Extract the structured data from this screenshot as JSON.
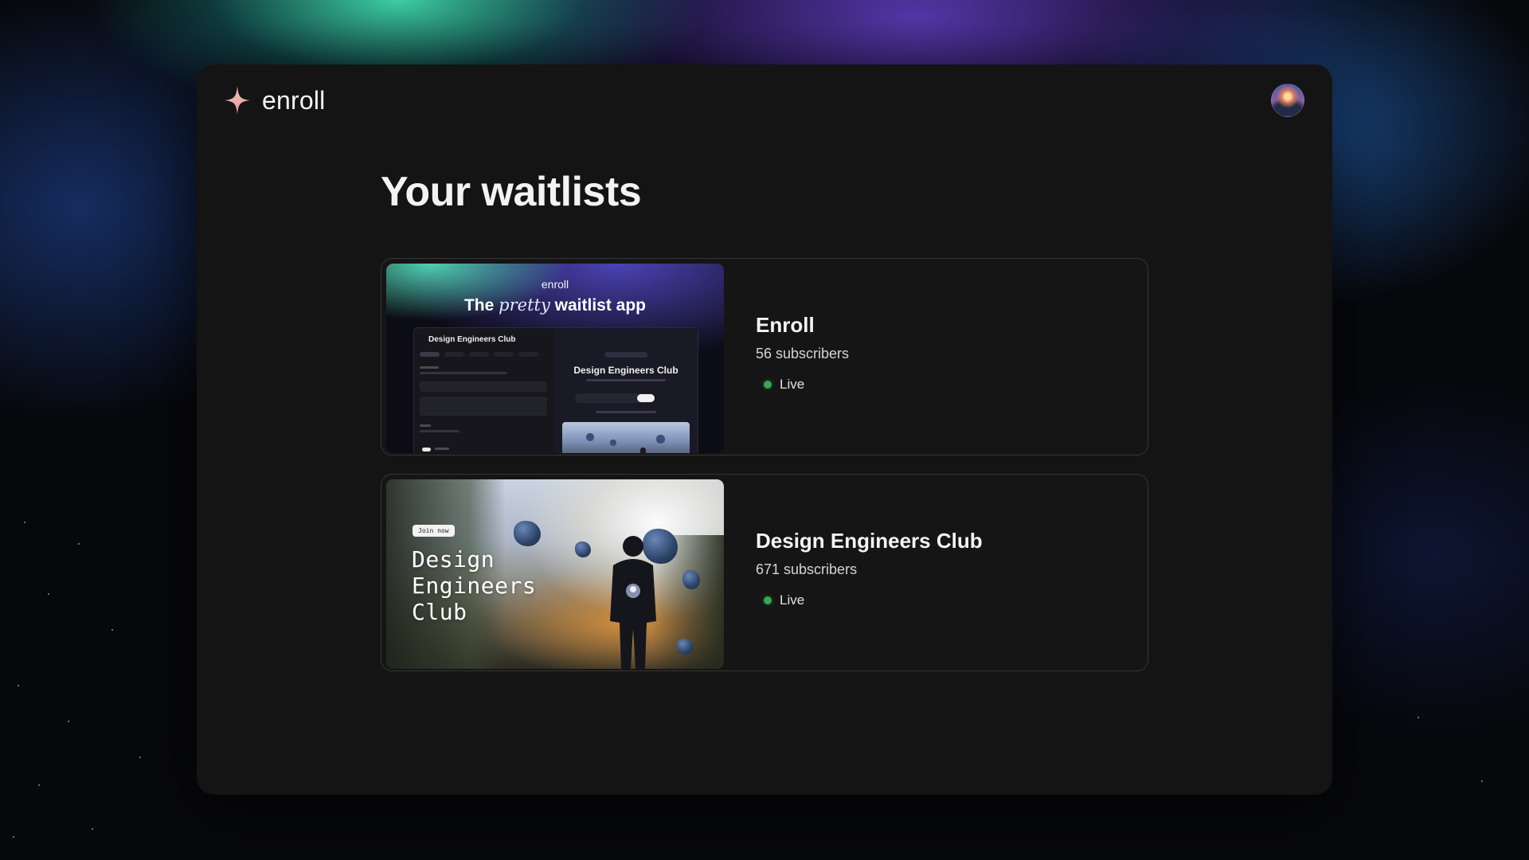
{
  "app": {
    "brand_name": "enroll",
    "accent_color": "#f0a8a0",
    "status_color": "#34a853"
  },
  "page": {
    "title": "Your waitlists"
  },
  "waitlists": [
    {
      "name": "Enroll",
      "subscribers": "56 subscribers",
      "status": "Live",
      "thumbnail": {
        "brand": "enroll",
        "headline_pre": "The",
        "headline_em": "pretty",
        "headline_post": "waitlist app",
        "mock_title": "Design Engineers Club",
        "mock_preview_title": "Design Engineers Club"
      }
    },
    {
      "name": "Design Engineers Club",
      "subscribers": "671 subscribers",
      "status": "Live",
      "thumbnail": {
        "badge": "Join now",
        "title_lines": [
          "Design",
          "Engineers",
          "Club"
        ]
      }
    }
  ],
  "icons": {
    "brand_icon": "sparkle-icon",
    "avatar": "user-avatar",
    "status_icon": "status-dot-icon"
  }
}
